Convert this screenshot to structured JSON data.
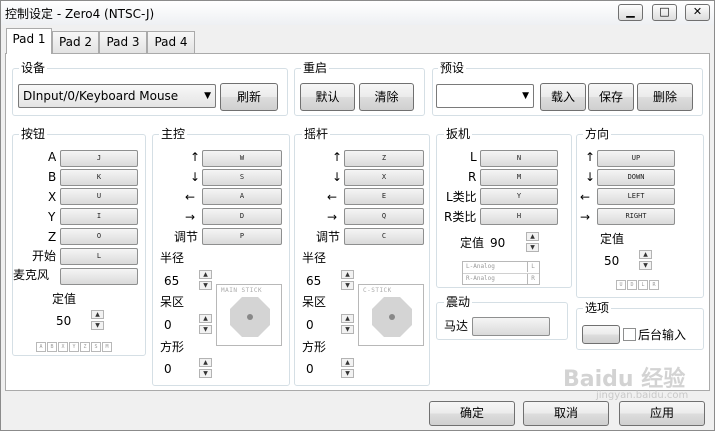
{
  "window": {
    "title": "控制设定 - Zero4 (NTSC-J)",
    "minimize_icon": "minimize-icon",
    "maximize_icon": "maximize-icon",
    "close_icon": "close-icon"
  },
  "tabs": [
    {
      "label": "Pad 1",
      "selected": true
    },
    {
      "label": "Pad 2"
    },
    {
      "label": "Pad 3"
    },
    {
      "label": "Pad 4"
    }
  ],
  "device": {
    "title": "设备",
    "selected": "DInput/0/Keyboard Mouse",
    "refresh_label": "刷新"
  },
  "reset": {
    "title": "重启",
    "default_label": "默认",
    "clear_label": "清除"
  },
  "preset": {
    "title": "预设",
    "selected": "",
    "load_label": "载入",
    "save_label": "保存",
    "delete_label": "删除"
  },
  "buttons": {
    "title": "按钮",
    "rows": [
      {
        "label": "A",
        "key": "J"
      },
      {
        "label": "B",
        "key": "K"
      },
      {
        "label": "X",
        "key": "U"
      },
      {
        "label": "Y",
        "key": "I"
      },
      {
        "label": "Z",
        "key": "O"
      },
      {
        "label": "开始",
        "key": "L"
      },
      {
        "label": "麦克风",
        "key": ""
      }
    ],
    "threshold_label": "定值",
    "threshold_value": "50",
    "indicators": [
      "A",
      "B",
      "X",
      "Y",
      "Z",
      "S",
      "M"
    ]
  },
  "main_stick": {
    "title": "主控",
    "rows": [
      {
        "label": "↑",
        "key": "W"
      },
      {
        "label": "↓",
        "key": "S"
      },
      {
        "label": "←",
        "key": "A"
      },
      {
        "label": "→",
        "key": "D"
      },
      {
        "label": "调节",
        "key": "P"
      }
    ],
    "radius_label": "半径",
    "radius_value": "65",
    "deadzone_label": "呆区",
    "deadzone_value": "0",
    "square_label": "方形",
    "square_value": "0",
    "preview_caption": "MAIN STICK"
  },
  "c_stick": {
    "title": "摇杆",
    "rows": [
      {
        "label": "↑",
        "key": "Z"
      },
      {
        "label": "↓",
        "key": "X"
      },
      {
        "label": "←",
        "key": "E"
      },
      {
        "label": "→",
        "key": "Q"
      },
      {
        "label": "调节",
        "key": "C"
      }
    ],
    "radius_label": "半径",
    "radius_value": "65",
    "deadzone_label": "呆区",
    "deadzone_value": "0",
    "square_label": "方形",
    "square_value": "0",
    "preview_caption": "C-STICK"
  },
  "triggers": {
    "title": "扳机",
    "rows": [
      {
        "label": "L",
        "key": "N"
      },
      {
        "label": "R",
        "key": "M"
      },
      {
        "label": "L类比",
        "key": "Y"
      },
      {
        "label": "R类比",
        "key": "H"
      }
    ],
    "threshold_label": "定值",
    "threshold_value": "90",
    "analog_rows": [
      {
        "name": "L-Analog",
        "key": "L"
      },
      {
        "name": "R-Analog",
        "key": "R"
      }
    ]
  },
  "dpad": {
    "title": "方向",
    "rows": [
      {
        "label": "↑",
        "key": "UP"
      },
      {
        "label": "↓",
        "key": "DOWN"
      },
      {
        "label": "←",
        "key": "LEFT"
      },
      {
        "label": "→",
        "key": "RIGHT"
      }
    ],
    "threshold_label": "定值",
    "threshold_value": "50",
    "indicators": [
      "U",
      "D",
      "L",
      "R"
    ]
  },
  "rumble": {
    "title": "震动",
    "motor_label": "马达",
    "motor_key": ""
  },
  "options": {
    "title": "选项",
    "button_label": "",
    "background_input_label": "后台输入",
    "background_input_checked": false
  },
  "footer": {
    "ok_label": "确定",
    "cancel_label": "取消",
    "apply_label": "应用"
  },
  "watermark": "Baidu 经验",
  "watermark_sub": "jingyan.baidu.com"
}
